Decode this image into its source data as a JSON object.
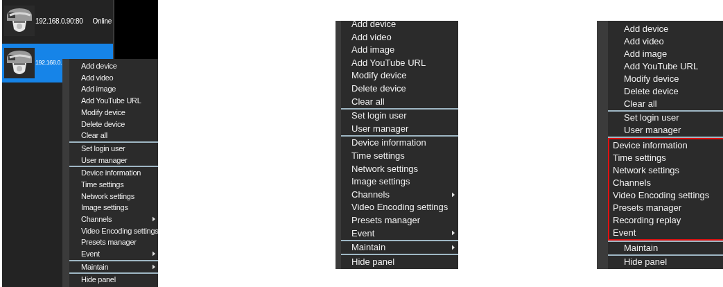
{
  "panels": [
    {
      "kind": "device_list",
      "devices": [
        {
          "address": "192.168.0.90:80",
          "status": "Online",
          "selected": false
        },
        {
          "address": "192.168.0.",
          "selected": true
        }
      ],
      "menu": {
        "sections": [
          {
            "highlighted": false,
            "items": [
              {
                "label": "Add device"
              },
              {
                "label": "Add video"
              },
              {
                "label": "Add image"
              },
              {
                "label": "Add YouTube URL"
              },
              {
                "label": "Modify device"
              },
              {
                "label": "Delete device"
              },
              {
                "label": "Clear all"
              }
            ]
          },
          {
            "highlighted": false,
            "items": [
              {
                "label": "Set login user"
              },
              {
                "label": "User manager"
              }
            ]
          },
          {
            "highlighted": false,
            "items": [
              {
                "label": "Device information"
              },
              {
                "label": "Time settings"
              },
              {
                "label": "Network settings"
              },
              {
                "label": "Image settings"
              },
              {
                "label": "Channels",
                "submenu": true
              },
              {
                "label": "Video Encoding settings"
              },
              {
                "label": "Presets manager"
              },
              {
                "label": "Event",
                "submenu": true
              }
            ]
          },
          {
            "highlighted": false,
            "items": [
              {
                "label": "Maintain",
                "submenu": true
              }
            ]
          },
          {
            "highlighted": false,
            "items": [
              {
                "label": "Hide panel"
              }
            ]
          }
        ]
      }
    },
    {
      "kind": "menu",
      "menu": {
        "sections": [
          {
            "highlighted": false,
            "items": [
              {
                "label": "Add device"
              },
              {
                "label": "Add video"
              },
              {
                "label": "Add image"
              },
              {
                "label": "Add YouTube URL"
              },
              {
                "label": "Modify device"
              },
              {
                "label": "Delete device"
              },
              {
                "label": "Clear all"
              }
            ]
          },
          {
            "highlighted": false,
            "items": [
              {
                "label": "Set login user"
              },
              {
                "label": "User manager"
              }
            ]
          },
          {
            "highlighted": false,
            "items": [
              {
                "label": "Device information"
              },
              {
                "label": "Time settings"
              },
              {
                "label": "Network settings"
              },
              {
                "label": "Image settings"
              },
              {
                "label": "Channels",
                "submenu": true
              },
              {
                "label": "Video Encoding settings"
              },
              {
                "label": "Presets manager"
              },
              {
                "label": "Event",
                "submenu": true
              }
            ]
          },
          {
            "highlighted": false,
            "items": [
              {
                "label": "Maintain",
                "submenu": true
              }
            ]
          },
          {
            "highlighted": false,
            "items": [
              {
                "label": "Hide panel"
              }
            ]
          }
        ]
      }
    },
    {
      "kind": "menu",
      "menu": {
        "sections": [
          {
            "highlighted": false,
            "items": [
              {
                "label": "Add device"
              },
              {
                "label": "Add video"
              },
              {
                "label": "Add image"
              },
              {
                "label": "Add YouTube URL"
              },
              {
                "label": "Modify device"
              },
              {
                "label": "Delete device"
              },
              {
                "label": "Clear all"
              }
            ]
          },
          {
            "highlighted": false,
            "items": [
              {
                "label": "Set login user"
              },
              {
                "label": "User manager"
              }
            ]
          },
          {
            "highlighted": true,
            "items": [
              {
                "label": "Device information"
              },
              {
                "label": "Time settings"
              },
              {
                "label": "Network settings"
              },
              {
                "label": "Channels"
              },
              {
                "label": "Video Encoding settings"
              },
              {
                "label": "Presets manager"
              },
              {
                "label": "Recording replay"
              },
              {
                "label": "Event"
              }
            ]
          },
          {
            "highlighted": false,
            "items": [
              {
                "label": "Maintain"
              }
            ]
          },
          {
            "highlighted": false,
            "items": [
              {
                "label": "Hide panel"
              }
            ]
          }
        ]
      }
    }
  ]
}
